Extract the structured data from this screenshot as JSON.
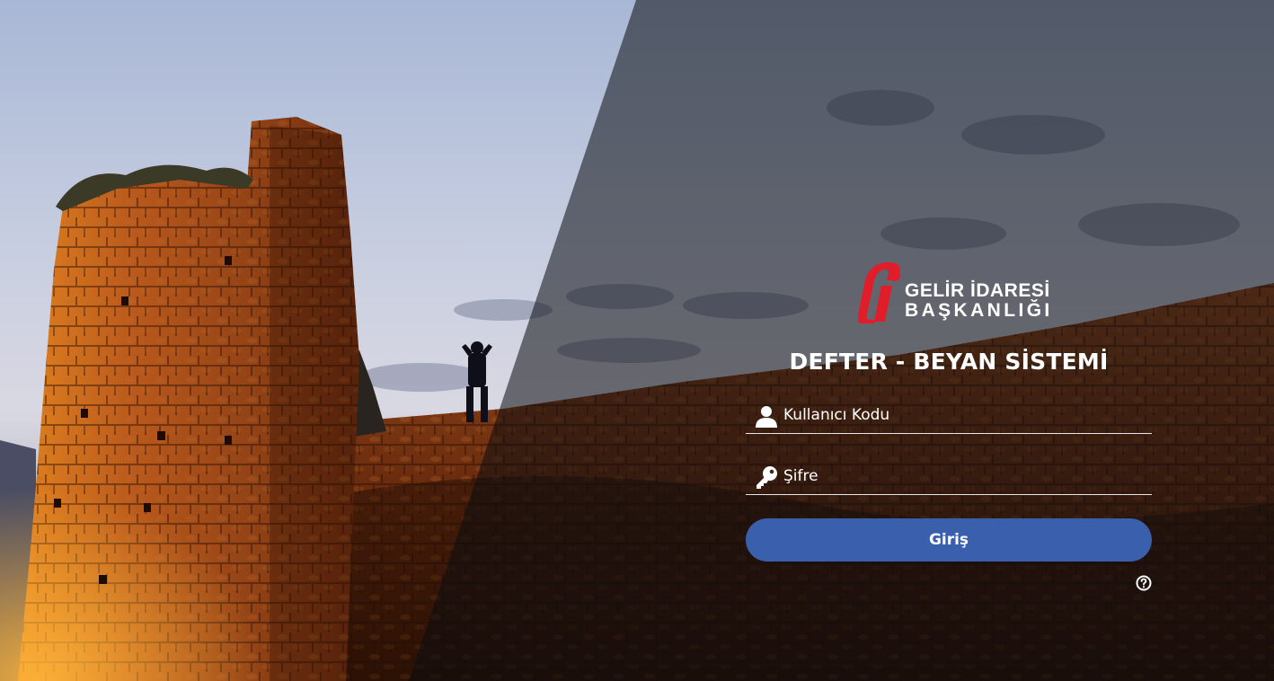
{
  "brand": {
    "name_line1": "GELİR İDARESİ",
    "name_line2": "BAŞKANLIĞI",
    "logo_color": "#e11d2a",
    "logo_icon": "gib-logo-icon"
  },
  "system_title": "DEFTER - BEYAN SİSTEMİ",
  "form": {
    "username": {
      "placeholder": "Kullanıcı Kodu",
      "value": "",
      "icon": "user-icon"
    },
    "password": {
      "placeholder": "Şifre",
      "value": "",
      "icon": "key-icon"
    },
    "submit_label": "Giriş",
    "submit_color": "#3a5fad",
    "help_icon": "question-circle-icon"
  }
}
